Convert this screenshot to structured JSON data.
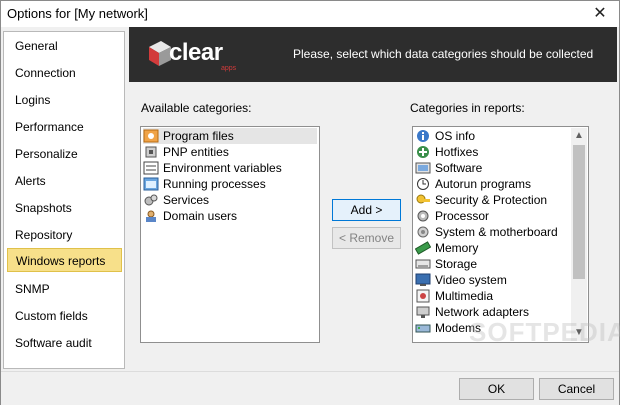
{
  "window": {
    "title": "Options for [My network]"
  },
  "sidebar": {
    "items": [
      {
        "label": "General"
      },
      {
        "label": "Connection"
      },
      {
        "label": "Logins"
      },
      {
        "label": "Performance"
      },
      {
        "label": "Personalize"
      },
      {
        "label": "Alerts"
      },
      {
        "label": "Snapshots"
      },
      {
        "label": "Repository"
      },
      {
        "label": "Windows reports",
        "active": true
      },
      {
        "label": "SNMP"
      },
      {
        "label": "Custom fields"
      },
      {
        "label": "Software audit"
      }
    ]
  },
  "banner": {
    "logo_text": "clear",
    "logo_sub": "apps",
    "message": "Please, select which data categories should be collected"
  },
  "available": {
    "label": "Available categories:",
    "items": [
      {
        "label": "Program files",
        "icon": "program-files-icon"
      },
      {
        "label": "PNP entities",
        "icon": "pnp-icon"
      },
      {
        "label": "Environment variables",
        "icon": "environment-icon"
      },
      {
        "label": "Running processes",
        "icon": "processes-icon"
      },
      {
        "label": "Services",
        "icon": "services-icon"
      },
      {
        "label": "Domain users",
        "icon": "users-icon"
      }
    ]
  },
  "reports": {
    "label": "Categories in reports:",
    "items": [
      {
        "label": "OS info",
        "icon": "info-icon"
      },
      {
        "label": "Hotfixes",
        "icon": "hotfix-icon"
      },
      {
        "label": "Software",
        "icon": "software-icon"
      },
      {
        "label": "Autorun programs",
        "icon": "autorun-icon"
      },
      {
        "label": "Security & Protection",
        "icon": "security-icon"
      },
      {
        "label": "Processor",
        "icon": "processor-icon"
      },
      {
        "label": "System & motherboard",
        "icon": "motherboard-icon"
      },
      {
        "label": "Memory",
        "icon": "memory-icon"
      },
      {
        "label": "Storage",
        "icon": "storage-icon"
      },
      {
        "label": "Video system",
        "icon": "video-icon"
      },
      {
        "label": "Multimedia",
        "icon": "multimedia-icon"
      },
      {
        "label": "Network adapters",
        "icon": "network-icon"
      },
      {
        "label": "Modems",
        "icon": "modem-icon"
      }
    ]
  },
  "buttons": {
    "add": "Add >",
    "remove": "< Remove",
    "ok": "OK",
    "cancel": "Cancel"
  },
  "watermark": "SOFTPEDIA",
  "colors": {
    "active_item": "#f7e08a",
    "banner_bg": "#2d2d2d",
    "logo_red": "#d23b3b"
  }
}
